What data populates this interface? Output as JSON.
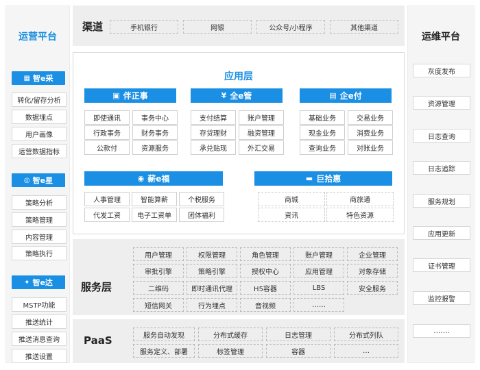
{
  "left_panel": {
    "title": "运营平台",
    "groups": [
      {
        "title": "智e采",
        "icon": "chart-icon",
        "items": [
          "转化/留存分析",
          "数据埋点",
          "用户画像",
          "运营数据指标"
        ]
      },
      {
        "title": "智e星",
        "icon": "target-icon",
        "items": [
          "策略分析",
          "策略管理",
          "内容管理",
          "策略执行"
        ]
      },
      {
        "title": "智e达",
        "icon": "bulb-icon",
        "items": [
          "MSTP功能",
          "推送统计",
          "推送消息查询",
          "推送设置"
        ]
      }
    ]
  },
  "channel": {
    "title": "渠道",
    "items": [
      "手机银行",
      "网银",
      "公众号/小程序",
      "其他渠道"
    ]
  },
  "app_layer": {
    "title": "应用层",
    "modules": [
      {
        "title": "伴正事",
        "icon": "briefcase-icon",
        "items": [
          "即使通讯",
          "事务中心",
          "行政事务",
          "财务事务",
          "公款付",
          "资源服务"
        ]
      },
      {
        "title": "全e管",
        "icon": "yen-icon",
        "items": [
          "支付结算",
          "账户管理",
          "存贷理财",
          "融资管理",
          "承兑贴现",
          "外汇交易"
        ]
      },
      {
        "title": "企e付",
        "icon": "card-icon",
        "items": [
          "基础业务",
          "交易业务",
          "现金业务",
          "消费业务",
          "查询业务",
          "对账业务"
        ]
      },
      {
        "title": "薪e福",
        "icon": "coin-icon",
        "items": [
          "人事管理",
          "智能算薪",
          "个税服务",
          "代发工资",
          "电子工资单",
          "团体福利"
        ]
      },
      {
        "title": "巨拾惠",
        "icon": "shop-icon",
        "items": [
          "商城",
          "商旅通",
          "资讯",
          "特色资源"
        ]
      }
    ]
  },
  "service_layer": {
    "title": "服务层",
    "items": [
      "用户管理",
      "权限管理",
      "角色管理",
      "账户管理",
      "企业管理",
      "审批引擎",
      "策略引擎",
      "授权中心",
      "应用管理",
      "对象存储",
      "二维码",
      "即时通讯代理",
      "H5容器",
      "LBS",
      "安全服务",
      "短信网关",
      "行为埋点",
      "音视频",
      "……"
    ]
  },
  "paas": {
    "title": "PaaS",
    "items": [
      "服务自动发现",
      "分布式缓存",
      "日志管理",
      "分布式列队",
      "服务定义、部署",
      "标签管理",
      "容器",
      "…"
    ]
  },
  "right_panel": {
    "title": "运维平台",
    "items": [
      "灰度发布",
      "资源管理",
      "日志查询",
      "日志追踪",
      "服务规划",
      "应用更新",
      "证书管理",
      "监控报警",
      "……."
    ]
  }
}
